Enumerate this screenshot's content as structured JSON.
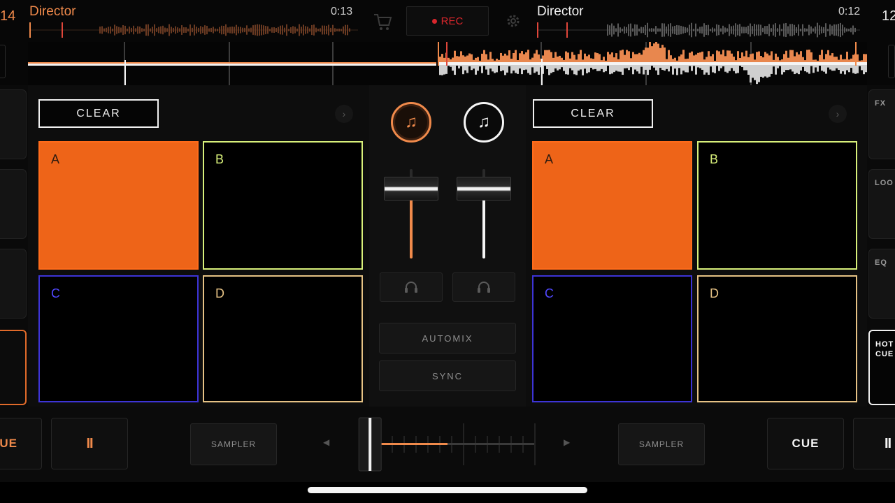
{
  "deck_a": {
    "track_title": "Director",
    "time": "0:13",
    "edge_number": "14",
    "clear_label": "CLEAR",
    "next_label": "›",
    "pads": [
      "A",
      "B",
      "C",
      "D"
    ],
    "cue_label": "CUE",
    "play_label": "II",
    "sampler_label": "SAMPLER"
  },
  "deck_b": {
    "track_title": "Director",
    "time": "0:12",
    "edge_number": "12",
    "clear_label": "CLEAR",
    "next_label": "›",
    "pads": [
      "A",
      "B",
      "C",
      "D"
    ],
    "cue_label": "CUE",
    "play_label": "II",
    "sampler_label": "SAMPLER"
  },
  "top": {
    "rec_label": "REC"
  },
  "mixer": {
    "automix_label": "AUTOMIX",
    "sync_label": "SYNC",
    "volume_a": 0.78,
    "volume_b": 0.78,
    "crossfader": 0.08
  },
  "side_panel": {
    "fx_label": "FX",
    "loop_label": "LOO",
    "eq_label": "EQ",
    "hotcue_label_1": "HOT",
    "hotcue_label_2": "CUE"
  },
  "icons": {
    "cart": "shopping-cart-icon",
    "settings": "gear-icon",
    "headphones": "headphones-icon",
    "music": "music-note-icon",
    "prev": "triangle-left-icon",
    "next": "triangle-right-icon"
  },
  "colors": {
    "deck_a_accent": "#f08a4b",
    "deck_b_accent": "#f5f5f5",
    "rec": "#d9262c",
    "pad_a": "#ee6418",
    "pad_b": "#d8f07a",
    "pad_c": "#3d34d6",
    "pad_d": "#e6c285"
  }
}
